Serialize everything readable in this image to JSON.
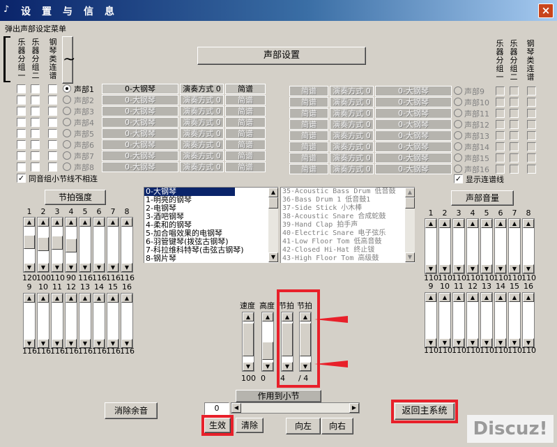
{
  "window": {
    "title": "设置与信息",
    "close": "×"
  },
  "menu": {
    "popup_label": "弹出声部设定菜单"
  },
  "left_headers": [
    {
      "label": "乐器分组一"
    },
    {
      "label": "乐器分组二"
    },
    {
      "label": "钢琴类连谱"
    }
  ],
  "right_headers": [
    {
      "label": "乐器分组一"
    },
    {
      "label": "乐器分组二"
    },
    {
      "label": "钢琴类连谱"
    }
  ],
  "voice_settings_button": "声部设置",
  "left_voices": [
    {
      "name": "声部1",
      "instrument": "0-大钢琴",
      "mode": "演奏方式 0",
      "notation": "简谱",
      "active": true
    },
    {
      "name": "声部2",
      "instrument": "0-大钢琴",
      "mode": "演奏方式 0",
      "notation": "简谱",
      "active": false
    },
    {
      "name": "声部3",
      "instrument": "0-大钢琴",
      "mode": "演奏方式 0",
      "notation": "简谱",
      "active": false
    },
    {
      "name": "声部4",
      "instrument": "0-大钢琴",
      "mode": "演奏方式 0",
      "notation": "简谱",
      "active": false
    },
    {
      "name": "声部5",
      "instrument": "0-大钢琴",
      "mode": "演奏方式 0",
      "notation": "简谱",
      "active": false
    },
    {
      "name": "声部6",
      "instrument": "0-大钢琴",
      "mode": "演奏方式 0",
      "notation": "简谱",
      "active": false
    },
    {
      "name": "声部7",
      "instrument": "0-大钢琴",
      "mode": "演奏方式 0",
      "notation": "简谱",
      "active": false
    },
    {
      "name": "声部8",
      "instrument": "0-大钢琴",
      "mode": "演奏方式 0",
      "notation": "简谱",
      "active": false
    }
  ],
  "right_voices": [
    {
      "name": "声部9",
      "instrument": "0-大钢琴",
      "mode": "演奏方式 0",
      "notation": "简谱"
    },
    {
      "name": "声部10",
      "instrument": "0-大钢琴",
      "mode": "演奏方式 0",
      "notation": "简谱"
    },
    {
      "name": "声部11",
      "instrument": "0-大钢琴",
      "mode": "演奏方式 0",
      "notation": "简谱"
    },
    {
      "name": "声部12",
      "instrument": "0-大钢琴",
      "mode": "演奏方式 0",
      "notation": "简谱"
    },
    {
      "name": "声部13",
      "instrument": "0-大钢琴",
      "mode": "演奏方式 0",
      "notation": "简谱"
    },
    {
      "name": "声部14",
      "instrument": "0-大钢琴",
      "mode": "演奏方式 0",
      "notation": "简谱"
    },
    {
      "name": "声部15",
      "instrument": "0-大钢琴",
      "mode": "演奏方式 0",
      "notation": "简谱"
    },
    {
      "name": "声部16",
      "instrument": "0-大钢琴",
      "mode": "演奏方式 0",
      "notation": "简谱"
    }
  ],
  "same_tone_label": "同音组小节线不相连",
  "show_tie_label": "显示连谱线",
  "beat_strength_button": "节拍强度",
  "voice_volume_button": "声部音量",
  "instrument_list": [
    "0-大钢琴",
    "1-明亮的钢琴",
    "2-电钢琴",
    "3-酒吧钢琴",
    "4-柔和的钢琴",
    "5-加合唱效果的电钢琴",
    "6-羽管键琴(拨弦古钢琴)",
    "7-科拉维科特琴(击弦古钢琴)",
    "8-钢片琴"
  ],
  "drum_list": [
    "35-Acoustic Bass Drum  低音鼓",
    "36-Bass Drum 1 低音鼓1",
    "37-Side Stick 小木棒",
    "38-Acoustic Snare 合成蛇鼓",
    "39-Hand Clap 拍手声",
    "40-Electric Snare 电子弦乐",
    "41-Low Floor Tom 低高音鼓",
    "42-Closed Hi-Hat 终止钹",
    "43-High Floor Tom 高级鼓"
  ],
  "beat_top": {
    "nums": [
      "1",
      "2",
      "3",
      "4",
      "5",
      "6",
      "7",
      "8"
    ],
    "vals": [
      "120",
      "100",
      "110",
      "90",
      "116",
      "116",
      "116",
      "116"
    ],
    "levels": [
      0.6,
      0.5,
      0.55,
      0.45,
      0,
      0,
      0,
      0
    ]
  },
  "beat_bottom": {
    "nums": [
      "9",
      "10",
      "11",
      "12",
      "13",
      "14",
      "15",
      "16"
    ],
    "vals": [
      "116",
      "116",
      "116",
      "116",
      "116",
      "116",
      "116",
      "116"
    ]
  },
  "vol_top": {
    "nums": [
      "1",
      "2",
      "3",
      "4",
      "5",
      "6",
      "7",
      "8"
    ],
    "vals": [
      "110",
      "110",
      "110",
      "110",
      "110",
      "110",
      "110",
      "110"
    ]
  },
  "vol_bottom": {
    "nums": [
      "9",
      "10",
      "11",
      "12",
      "13",
      "14",
      "15",
      "16"
    ],
    "vals": [
      "110",
      "110",
      "110",
      "110",
      "110",
      "110",
      "110",
      "110"
    ]
  },
  "ctrl_labels": [
    "速度",
    "高度",
    "节拍",
    "节拍"
  ],
  "ctrl_vals": [
    "100",
    "0",
    "4",
    "/ 4"
  ],
  "apply_label": "作用到小节",
  "measure_value": "0",
  "buttons": {
    "clear_rest": "消除余音",
    "apply": "生效",
    "clear": "清除",
    "left": "向左",
    "right": "向右",
    "back_main": "返回主系统"
  },
  "watermark": "Discuz!",
  "colors": {
    "highlight": "#e8202a",
    "title_start": "#0a246a",
    "title_end": "#a6caf0"
  }
}
